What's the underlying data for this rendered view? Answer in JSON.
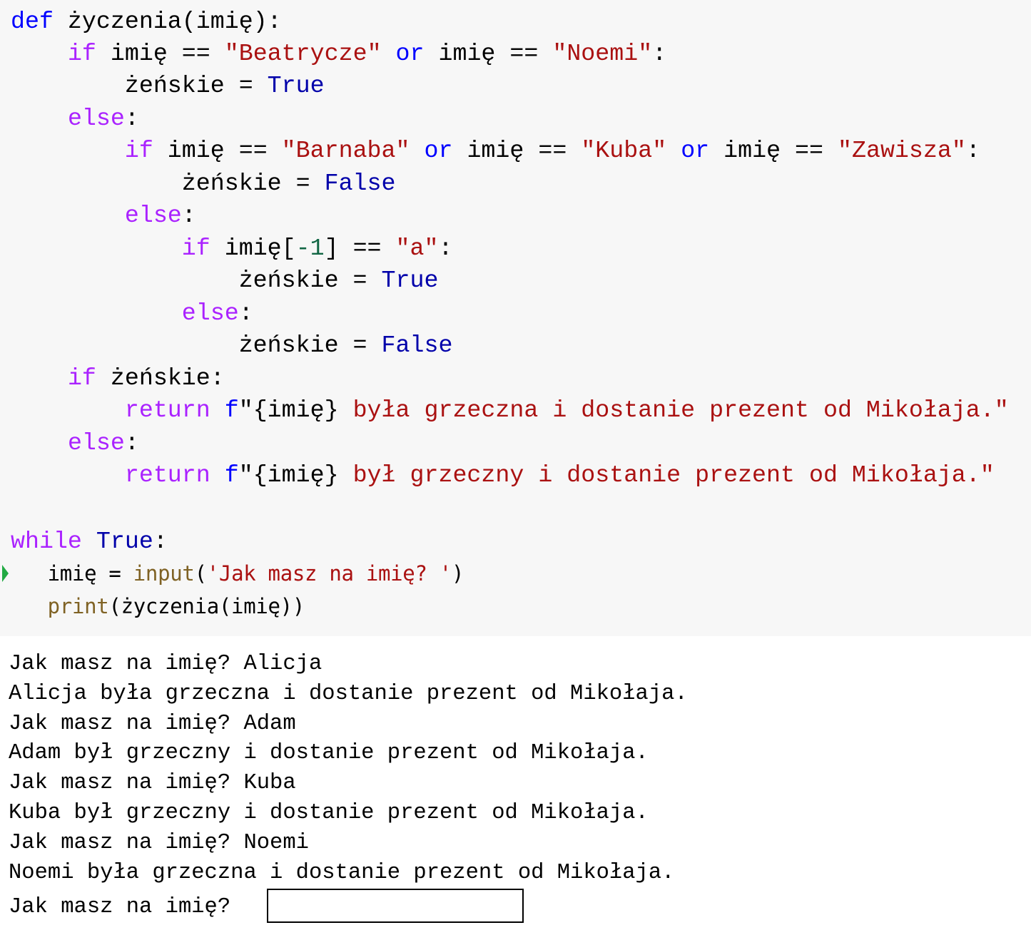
{
  "code_cell": {
    "lines": [
      [
        {
          "t": "def",
          "c": "def"
        },
        {
          "t": " życzenia(imię):",
          "c": ""
        }
      ],
      [
        {
          "t": "    ",
          "c": ""
        },
        {
          "t": "if",
          "c": "kw"
        },
        {
          "t": " imię == ",
          "c": ""
        },
        {
          "t": "\"Beatrycze\"",
          "c": "str"
        },
        {
          "t": " ",
          "c": ""
        },
        {
          "t": "or",
          "c": "def"
        },
        {
          "t": " imię == ",
          "c": ""
        },
        {
          "t": "\"Noemi\"",
          "c": "str"
        },
        {
          "t": ":",
          "c": ""
        }
      ],
      [
        {
          "t": "        żeńskie = ",
          "c": ""
        },
        {
          "t": "True",
          "c": "const"
        }
      ],
      [
        {
          "t": "    ",
          "c": ""
        },
        {
          "t": "else",
          "c": "kw"
        },
        {
          "t": ":",
          "c": ""
        }
      ],
      [
        {
          "t": "        ",
          "c": ""
        },
        {
          "t": "if",
          "c": "kw"
        },
        {
          "t": " imię == ",
          "c": ""
        },
        {
          "t": "\"Barnaba\"",
          "c": "str"
        },
        {
          "t": " ",
          "c": ""
        },
        {
          "t": "or",
          "c": "def"
        },
        {
          "t": " imię == ",
          "c": ""
        },
        {
          "t": "\"Kuba\"",
          "c": "str"
        },
        {
          "t": " ",
          "c": ""
        },
        {
          "t": "or",
          "c": "def"
        },
        {
          "t": " imię == ",
          "c": ""
        },
        {
          "t": "\"Zawisza\"",
          "c": "str"
        },
        {
          "t": ":",
          "c": ""
        }
      ],
      [
        {
          "t": "            żeńskie = ",
          "c": ""
        },
        {
          "t": "False",
          "c": "const"
        }
      ],
      [
        {
          "t": "        ",
          "c": ""
        },
        {
          "t": "else",
          "c": "kw"
        },
        {
          "t": ":",
          "c": ""
        }
      ],
      [
        {
          "t": "            ",
          "c": ""
        },
        {
          "t": "if",
          "c": "kw"
        },
        {
          "t": " imię[",
          "c": ""
        },
        {
          "t": "-1",
          "c": "num"
        },
        {
          "t": "] == ",
          "c": ""
        },
        {
          "t": "\"a\"",
          "c": "str"
        },
        {
          "t": ":",
          "c": ""
        }
      ],
      [
        {
          "t": "                żeńskie = ",
          "c": ""
        },
        {
          "t": "True",
          "c": "const"
        }
      ],
      [
        {
          "t": "            ",
          "c": ""
        },
        {
          "t": "else",
          "c": "kw"
        },
        {
          "t": ":",
          "c": ""
        }
      ],
      [
        {
          "t": "                żeńskie = ",
          "c": ""
        },
        {
          "t": "False",
          "c": "const"
        }
      ],
      [
        {
          "t": "    ",
          "c": ""
        },
        {
          "t": "if",
          "c": "kw"
        },
        {
          "t": " żeńskie:",
          "c": ""
        }
      ],
      [
        {
          "t": "        ",
          "c": ""
        },
        {
          "t": "return",
          "c": "kw"
        },
        {
          "t": " ",
          "c": ""
        },
        {
          "t": "f",
          "c": "def"
        },
        {
          "t": "\"",
          "c": ""
        },
        {
          "t": "{imię}",
          "c": ""
        },
        {
          "t": " była grzeczna i dostanie prezent od Mikołaja.\"",
          "c": "str"
        }
      ],
      [
        {
          "t": "    ",
          "c": ""
        },
        {
          "t": "else",
          "c": "kw"
        },
        {
          "t": ":",
          "c": ""
        }
      ],
      [
        {
          "t": "        ",
          "c": ""
        },
        {
          "t": "return",
          "c": "kw"
        },
        {
          "t": " ",
          "c": ""
        },
        {
          "t": "f",
          "c": "def"
        },
        {
          "t": "\"",
          "c": ""
        },
        {
          "t": "{imię}",
          "c": ""
        },
        {
          "t": " był grzeczny i dostanie prezent od Mikołaja.\"",
          "c": "str"
        }
      ],
      [
        {
          "t": "",
          "c": ""
        }
      ],
      [
        {
          "t": "while",
          "c": "kw"
        },
        {
          "t": " ",
          "c": ""
        },
        {
          "t": "True",
          "c": "const"
        },
        {
          "t": ":",
          "c": ""
        }
      ],
      [
        {
          "t": "    imię = ",
          "c": ""
        },
        {
          "t": "input",
          "c": "bi"
        },
        {
          "t": "(",
          "c": ""
        },
        {
          "t": "'Jak masz na imię? '",
          "c": "str"
        },
        {
          "t": ")",
          "c": ""
        }
      ],
      [
        {
          "t": "    ",
          "c": ""
        },
        {
          "t": "print",
          "c": "bi"
        },
        {
          "t": "(życzenia(imię))",
          "c": ""
        }
      ]
    ]
  },
  "output": {
    "lines": [
      "Jak masz na imię? Alicja",
      "Alicja była grzeczna i dostanie prezent od Mikołaja.",
      "Jak masz na imię? Adam",
      "Adam był grzeczny i dostanie prezent od Mikołaja.",
      "Jak masz na imię? Kuba",
      "Kuba był grzeczny i dostanie prezent od Mikołaja.",
      "Jak masz na imię? Noemi",
      "Noemi była grzeczna i dostanie prezent od Mikołaja."
    ],
    "prompt": "Jak masz na imię?",
    "input_value": ""
  },
  "colors": {
    "keyword": "#aa22ff",
    "def_keyword": "#0000ff",
    "constant": "#0000aa",
    "string": "#aa1111",
    "number": "#116644",
    "builtin": "#7f6224",
    "run_marker": "#22aa44",
    "code_background": "#f7f7f7"
  }
}
